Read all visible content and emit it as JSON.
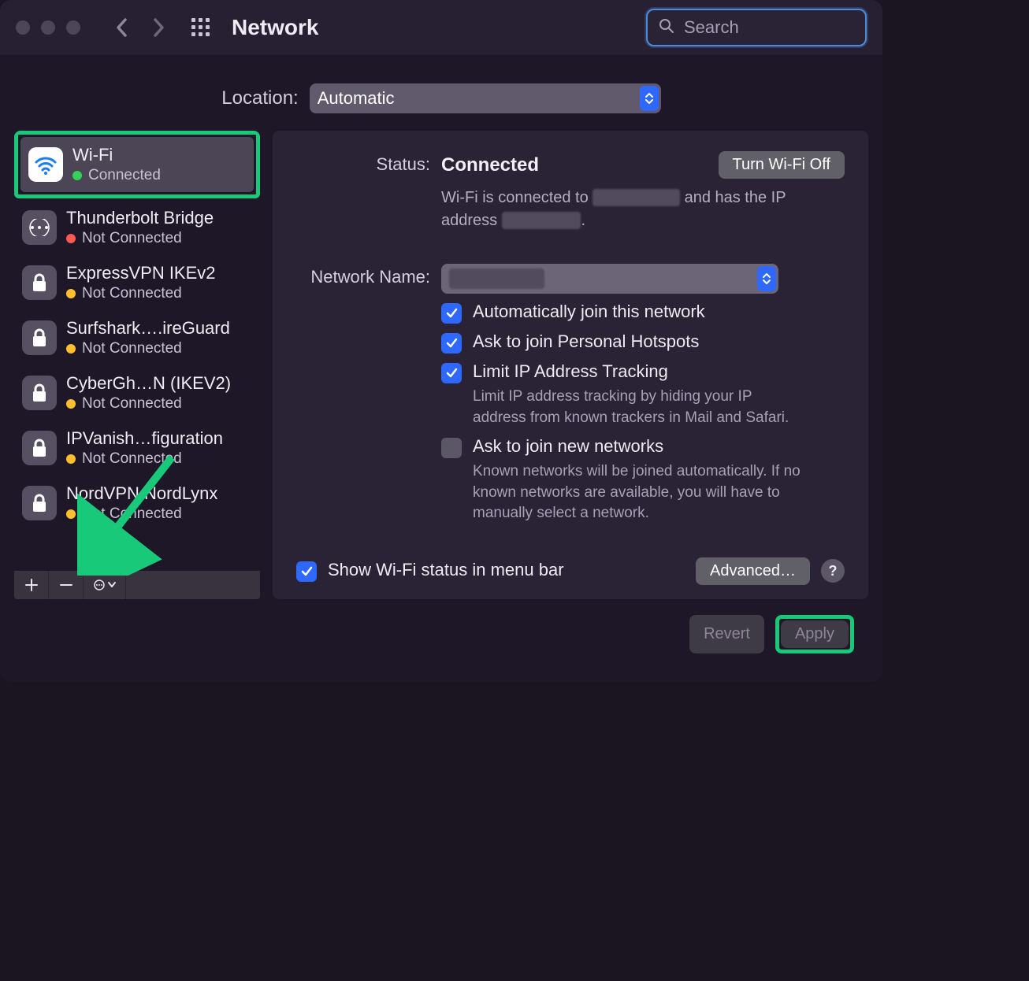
{
  "titlebar": {
    "title": "Network",
    "search_placeholder": "Search"
  },
  "location": {
    "label": "Location:",
    "value": "Automatic"
  },
  "sidebar": {
    "items": [
      {
        "name": "Wi-Fi",
        "status": "Connected",
        "dot": "green",
        "icon": "wifi",
        "selected": true
      },
      {
        "name": "Thunderbolt Bridge",
        "status": "Not Connected",
        "dot": "red",
        "icon": "bridge"
      },
      {
        "name": "ExpressVPN IKEv2",
        "status": "Not Connected",
        "dot": "orange",
        "icon": "lock"
      },
      {
        "name": "Surfshark….ireGuard",
        "status": "Not Connected",
        "dot": "orange",
        "icon": "lock"
      },
      {
        "name": "CyberGh…N (IKEV2)",
        "status": "Not Connected",
        "dot": "orange",
        "icon": "lock"
      },
      {
        "name": "IPVanish…figuration",
        "status": "Not Connected",
        "dot": "orange",
        "icon": "lock"
      },
      {
        "name": "NordVPN NordLynx",
        "status": "Not Connected",
        "dot": "orange",
        "icon": "lock"
      }
    ]
  },
  "detail": {
    "status_label": "Status:",
    "status_value": "Connected",
    "toggle_button": "Turn Wi-Fi Off",
    "status_desc_prefix": "Wi-Fi is connected to ",
    "status_desc_mid": " and has the IP address ",
    "network_name_label": "Network Name:",
    "network_name_value": "",
    "opt_auto_join": "Automatically join this network",
    "opt_personal_hotspot": "Ask to join Personal Hotspots",
    "opt_limit_ip": "Limit IP Address Tracking",
    "opt_limit_ip_desc": "Limit IP address tracking by hiding your IP address from known trackers in Mail and Safari.",
    "opt_ask_new": "Ask to join new networks",
    "opt_ask_new_desc": "Known networks will be joined automatically. If no known networks are available, you will have to manually select a network.",
    "show_menubar": "Show Wi-Fi status in menu bar",
    "advanced": "Advanced…",
    "help": "?"
  },
  "footer": {
    "revert": "Revert",
    "apply": "Apply"
  }
}
